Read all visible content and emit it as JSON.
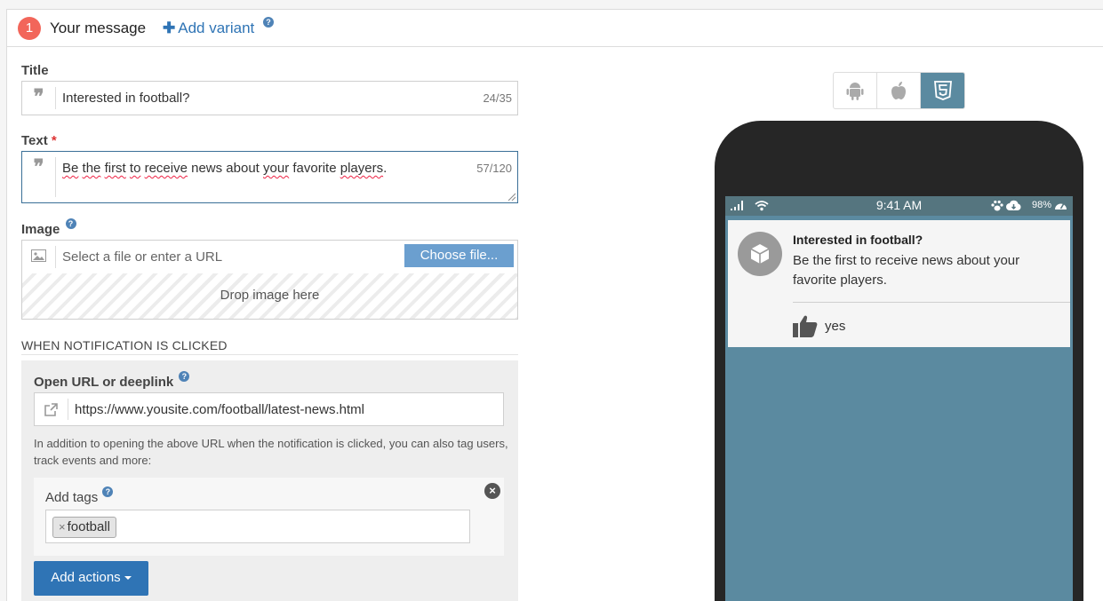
{
  "header": {
    "step_number": "1",
    "title": "Your message",
    "add_variant_label": "Add variant"
  },
  "form": {
    "title": {
      "label": "Title",
      "value": "Interested in football?",
      "counter": "24/35"
    },
    "text": {
      "label": "Text",
      "required_marker": "*",
      "value": "Be the first to receive news about your favorite players.",
      "counter": "57/120"
    },
    "image": {
      "label": "Image",
      "placeholder": "Select a file or enter a URL",
      "choose_label": "Choose file...",
      "drop_label": "Drop image here"
    },
    "click_section": {
      "heading": "WHEN NOTIFICATION IS CLICKED",
      "url_label": "Open URL or deeplink",
      "url_value": "https://www.yousite.com/football/latest-news.html",
      "help": "In addition to opening the above URL when the notification is clicked, you can also tag users, track events and more:",
      "tags_label": "Add tags",
      "tags": [
        "football"
      ],
      "add_actions_label": "Add actions"
    }
  },
  "preview": {
    "platforms": [
      "android",
      "apple",
      "html5"
    ],
    "active_platform": "html5",
    "status_time": "9:41 AM",
    "battery": "98%",
    "notification": {
      "title": "Interested in football?",
      "body": "Be the first to receive news about your favorite players.",
      "action_label": "yes"
    }
  },
  "colors": {
    "accent": "#2f74b5",
    "badge": "#f2665a",
    "preview_bg": "#5b8aa0",
    "phone_frame": "#262626"
  }
}
